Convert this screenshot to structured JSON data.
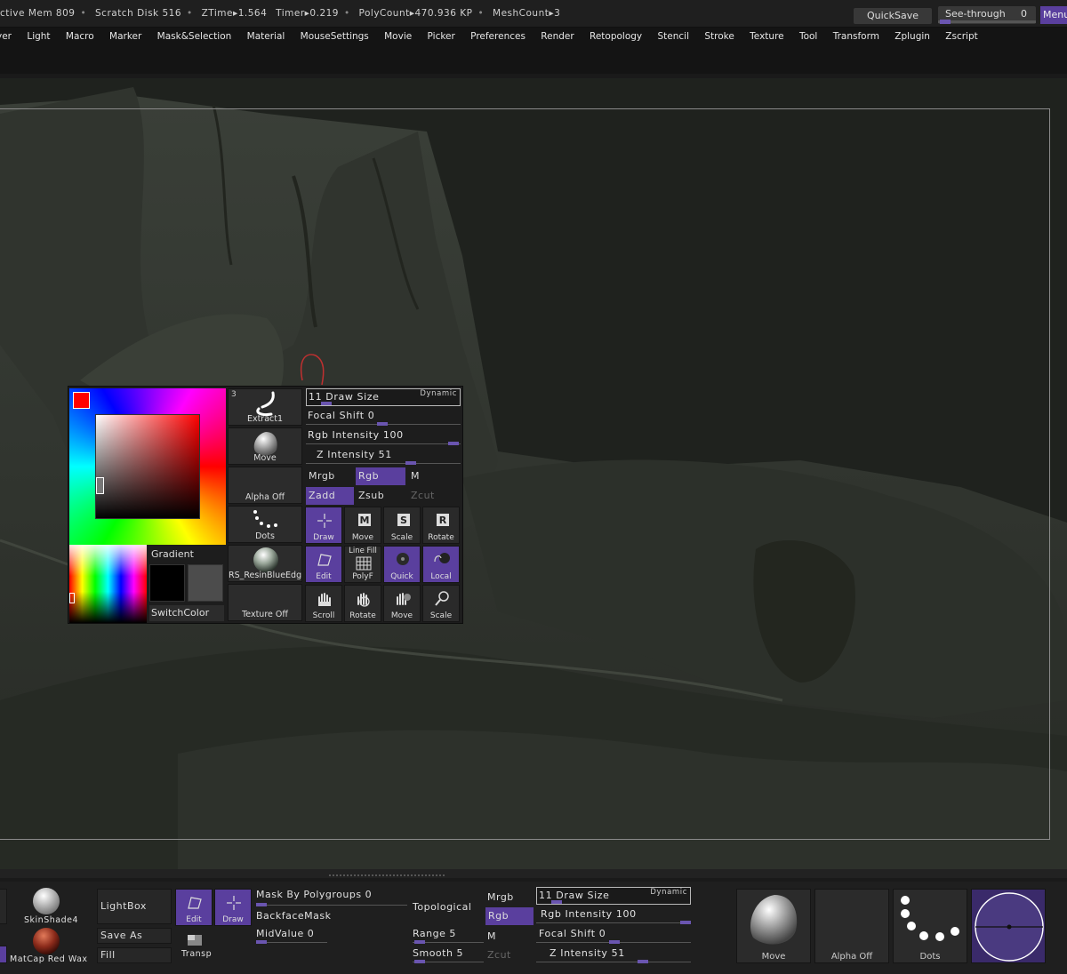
{
  "status": {
    "active_mem": "ctive Mem 809",
    "scratch_disk": "Scratch Disk 516",
    "ztime": "ZTime▸1.564",
    "timer": "Timer▸0.219",
    "polycount": "PolyCount▸470.936 KP",
    "meshcount": "MeshCount▸3",
    "quicksave": "QuickSave",
    "see_through_label": "See-through",
    "see_through_value": "0",
    "menus": "Menus"
  },
  "menu": [
    "yer",
    "Light",
    "Macro",
    "Marker",
    "Mask&Selection",
    "Material",
    "MouseSettings",
    "Movie",
    "Picker",
    "Preferences",
    "Render",
    "Retopology",
    "Stencil",
    "Stroke",
    "Texture",
    "Tool",
    "Transform",
    "Zplugin",
    "Zscript"
  ],
  "popup": {
    "gradient": "Gradient",
    "switchcolor": "SwitchColor",
    "thumbs": {
      "brush_count": "3",
      "brush": "Extract1",
      "brush2": "Move",
      "alpha": "Alpha  Off",
      "stroke": "Dots",
      "material": "RS_ResinBlueEdge",
      "texture": "Texture  Off"
    },
    "draw_size": "11 Draw Size",
    "dynamic": "Dynamic",
    "focal_shift": "Focal Shift 0",
    "rgb_intensity": "Rgb Intensity 100",
    "z_intensity": "Z Intensity 51",
    "mrgb": "Mrgb",
    "rgb": "Rgb",
    "m": "M",
    "zadd": "Zadd",
    "zsub": "Zsub",
    "zcut": "Zcut",
    "buttons": {
      "draw": "Draw",
      "move": "Move",
      "scale": "Scale",
      "rotate": "Rotate",
      "edit": "Edit",
      "line_fill": "Line Fill",
      "polyf": "PolyF",
      "quick": "Quick",
      "local": "Local",
      "scroll": "Scroll",
      "rotate2": "Rotate",
      "move2": "Move",
      "scale2": "Scale"
    }
  },
  "shelf": {
    "material1": "SkinShade4",
    "material2": "MatCap  Red  Wax",
    "lightbox": "LightBox",
    "save_as": "Save  As",
    "fill": "Fill",
    "edit": "Edit",
    "draw": "Draw",
    "transp": "Transp",
    "mask_by_polygroups": "Mask By Polygroups 0",
    "backfacemask": "BackfaceMask",
    "midvalue": "MidValue 0",
    "topological": "Topological",
    "range": "Range 5",
    "smooth": "Smooth 5",
    "mrgb": "Mrgb",
    "rgb": "Rgb",
    "m": "M",
    "zcut": "Zcut",
    "draw_size": "11 Draw Size",
    "dynamic": "Dynamic",
    "rgb_intensity": "Rgb Intensity 100",
    "focal_shift": "Focal Shift 0",
    "z_intensity": "Z Intensity 51",
    "brush": "Move",
    "alpha": "Alpha  Off",
    "stroke": "Dots"
  },
  "colors": {
    "accent": "#5a3f9e",
    "primary_color": "#ff0000"
  }
}
